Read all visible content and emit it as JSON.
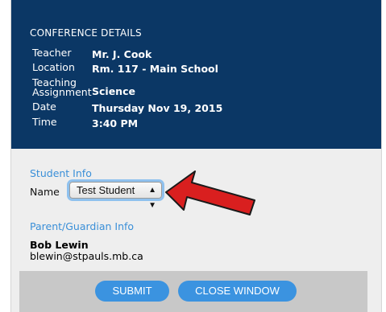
{
  "conference": {
    "heading": "CONFERENCE DETAILS",
    "rows": [
      {
        "label": "Teacher",
        "value": "Mr. J. Cook"
      },
      {
        "label": "Location",
        "value": "Rm. 117 - Main School"
      },
      {
        "label": "Teaching Assignment",
        "value": "Science"
      },
      {
        "label": "Date",
        "value": "Thursday Nov 19, 2015"
      },
      {
        "label": "Time",
        "value": "3:40 PM"
      }
    ]
  },
  "student": {
    "section_title": "Student Info",
    "name_label": "Name",
    "selected_student": "Test Student"
  },
  "parent": {
    "section_title": "Parent/Guardian Info",
    "name": "Bob Lewin",
    "email": "blewin@stpauls.mb.ca"
  },
  "buttons": {
    "submit_label": "SUBMIT",
    "close_label": "CLOSE WINDOW"
  },
  "colors": {
    "header_bg": "#0b3765",
    "accent": "#3b93e0",
    "arrow": "#d91f1f"
  }
}
